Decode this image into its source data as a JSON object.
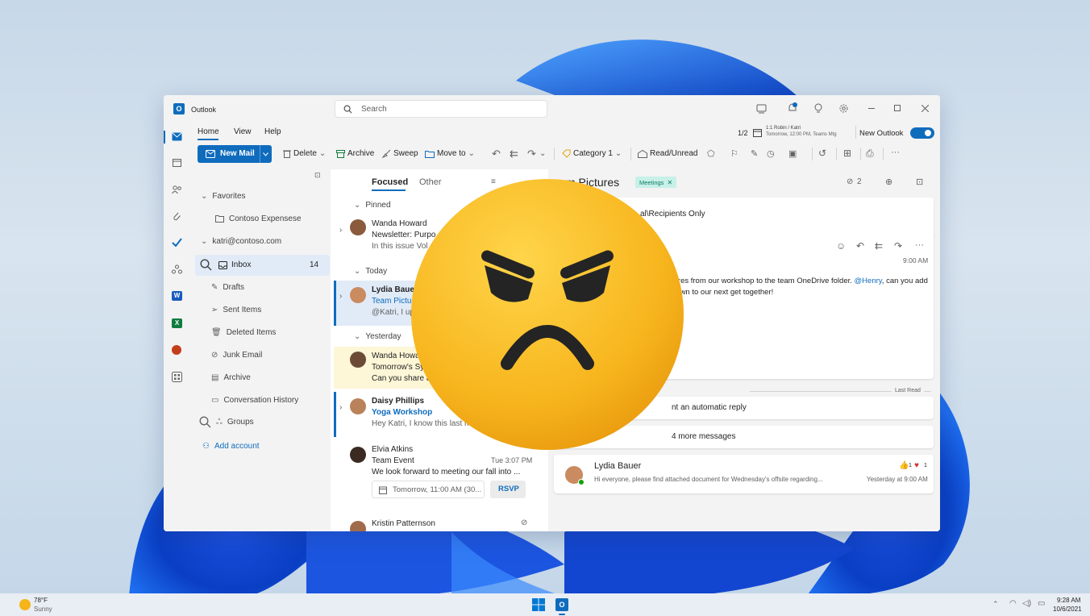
{
  "app": {
    "title": "Outlook",
    "search_placeholder": "Search",
    "accent": "#0f6cbd"
  },
  "ribbon": {
    "tabs": [
      "Home",
      "View",
      "Help"
    ],
    "meeting_counter": "1/2",
    "meeting_title": "1:1 Robin / Katri",
    "meeting_time": "Tomorrow, 12:00 PM, Teams Mtg",
    "new_outlook_label": "New Outlook",
    "new_outlook_on": true,
    "new_mail": "New Mail",
    "delete": "Delete",
    "archive": "Archive",
    "sweep": "Sweep",
    "move_to": "Move to",
    "category": "Category 1",
    "read_unread": "Read/Unread"
  },
  "folders": {
    "favorites": "Favorites",
    "favorite_items": [
      "Contoso Expensese"
    ],
    "account": "katri@contoso.com",
    "inbox": "Inbox",
    "inbox_count": "14",
    "items": [
      "Drafts",
      "Sent Items",
      "Deleted Items",
      "Junk Email",
      "Archive",
      "Conversation History"
    ],
    "groups": "Groups",
    "add_account": "Add account"
  },
  "list": {
    "tab_focused": "Focused",
    "tab_other": "Other",
    "section_pinned": "Pinned",
    "section_today": "Today",
    "section_yesterday": "Yesterday",
    "messages": [
      {
        "sender": "Wanda Howard",
        "subject": "Newsletter: Purpo",
        "preview": "In this issue Vol"
      },
      {
        "sender": "Lydia Bauer",
        "subject": "Team Pictu",
        "preview": "@Katri, I up"
      },
      {
        "sender": "Wanda Howa",
        "subject": "Tomorrow's Sy",
        "preview": "Can you share a"
      },
      {
        "sender": "Daisy Phillips",
        "subject": "Yoga Workshop",
        "preview": "Hey Katri, I know this last mi"
      },
      {
        "sender": "Elvia Atkins",
        "subject": "Team Event",
        "time": "Tue 3:07 PM",
        "preview": "We look forward to meeting our fall into ...",
        "event": "Tomorrow, 11:00 AM (30...",
        "rsvp": "RSVP"
      },
      {
        "sender": "Kristin Patternson",
        "subject": "",
        "preview": ""
      }
    ]
  },
  "reading": {
    "title_fragment": "m Pictures",
    "tag": "Meetings",
    "attach_count": "2",
    "recipients_fragment": "al\\Recipients Only",
    "time": "9:00 AM",
    "body_fragment_1": "tures from our workshop to the team OneDrive folder.",
    "mention": "@Henry",
    "body_fragment_1b": ", can you add",
    "body_fragment_2": "down to our next get together!",
    "last_read": "Last Read",
    "auto_reply_fragment": "nt an automatic reply",
    "more_messages_fragment": "4 more messages",
    "bottom_sender": "Lydia Bauer",
    "bottom_preview": "Hi everyone, please find attached document for Wednesday's offsite regarding...",
    "bottom_time": "Yesterday at 9:00 AM",
    "reaction_like": "1",
    "reaction_heart": "1"
  },
  "taskbar": {
    "temp": "78°F",
    "weather": "Sunny",
    "time": "9:28 AM",
    "date": "10/6/2021"
  },
  "overlay": {
    "face_color": "#f5b41a"
  }
}
